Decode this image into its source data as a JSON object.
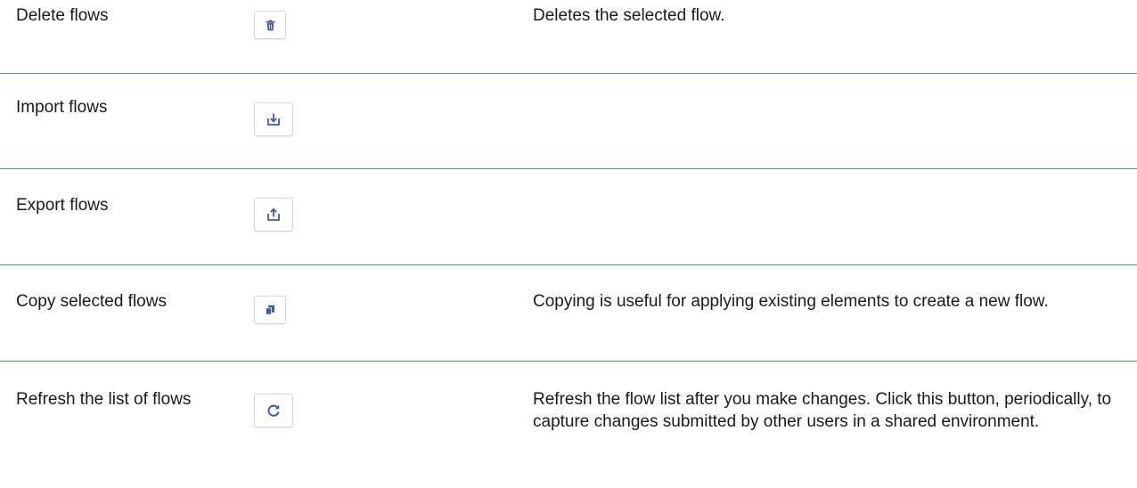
{
  "rows": [
    {
      "name": "Delete flows",
      "icon": "trash-icon",
      "description": "Deletes the selected flow."
    },
    {
      "name": "Import flows",
      "icon": "import-icon",
      "description": ""
    },
    {
      "name": "Export flows",
      "icon": "export-icon",
      "description": ""
    },
    {
      "name": "Copy selected flows",
      "icon": "copy-icon",
      "description": "Copying is useful for applying existing elements to create a new flow."
    },
    {
      "name": "Refresh the list of flows",
      "icon": "refresh-icon",
      "description": "Refresh the flow list after you make changes. Click this button, periodically, to capture changes submitted by other users in a shared environment."
    }
  ],
  "colors": {
    "divider": "#3a8fd6",
    "icon_blue": "#3b5bb5",
    "text": "#1a1a1a"
  }
}
